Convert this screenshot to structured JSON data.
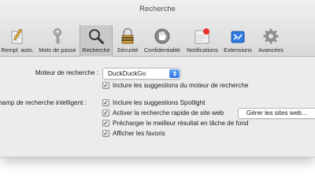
{
  "window": {
    "title": "Recherche"
  },
  "tabs": [
    {
      "label": "Rempl. auto.",
      "icon": "pencil-form-icon"
    },
    {
      "label": "Mots de passe",
      "icon": "key-icon"
    },
    {
      "label": "Recherche",
      "icon": "magnifier-icon",
      "active": true
    },
    {
      "label": "Sécurité",
      "icon": "lock-icon"
    },
    {
      "label": "Confidentialité",
      "icon": "hand-icon"
    },
    {
      "label": "Notifications",
      "icon": "notifications-icon"
    },
    {
      "label": "Extensions",
      "icon": "puzzle-icon"
    },
    {
      "label": "Avancées",
      "icon": "gear-icon"
    }
  ],
  "search_engine": {
    "label": "Moteur de recherche :",
    "selected": "DuckDuckGo",
    "include_suggestions": {
      "label": "Inclure les suggestions du moteur de recherche",
      "checked": true
    }
  },
  "smart_field": {
    "label": "hamp de recherche intelligent :",
    "options": [
      {
        "label": "Inclure les suggestions Spotlight",
        "checked": true
      },
      {
        "label": "Activer la recherche rapide de site web",
        "checked": true
      },
      {
        "label": "Précharger le meilleur résultat en tâche de fond",
        "checked": true
      },
      {
        "label": "Afficher les favoris",
        "checked": true
      }
    ],
    "manage_sites_button": "Gérer les sites web…"
  },
  "colors": {
    "accent": "#2d73e0",
    "notification_red": "#e8302c",
    "toolbar_active": "#c9c9c9"
  }
}
